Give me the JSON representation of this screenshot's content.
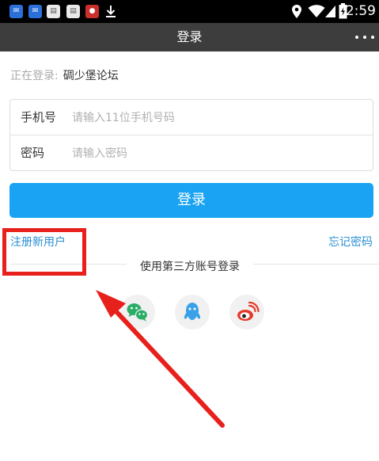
{
  "status_bar": {
    "time": "2:59",
    "notification_icons": [
      "app-notification-icon",
      "app-notification-icon",
      "message-icon",
      "message-icon",
      "app-icon",
      "download-icon"
    ],
    "system_icons": [
      "location-icon",
      "wifi-icon",
      "signal-icon",
      "battery-icon"
    ]
  },
  "header": {
    "title": "登录",
    "menu_icon": "more-icon"
  },
  "login_target": {
    "label": "正在登录:",
    "site": "碉少堡论坛"
  },
  "form": {
    "phone_label": "手机号",
    "phone_placeholder": "请输入11位手机号码",
    "password_label": "密码",
    "password_placeholder": "请输入密码"
  },
  "login_button": "登录",
  "register_link": "注册新用户",
  "forgot_link": "忘记密码",
  "third_party": {
    "label": "使用第三方账号登录",
    "providers": [
      "wechat-icon",
      "qq-icon",
      "weibo-icon"
    ]
  },
  "colors": {
    "accent": "#1aa3f2",
    "link": "#2a8fd6",
    "annotation": "#e8201b",
    "header_bg": "#3d3d3d"
  }
}
